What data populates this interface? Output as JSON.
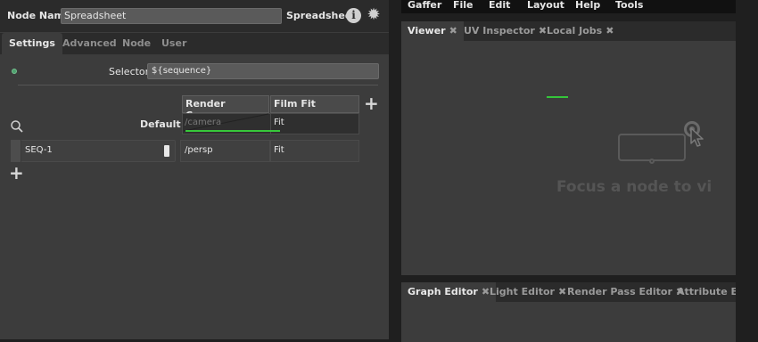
{
  "node_editor": {
    "node_name_label": "Node Name",
    "node_name_value": "Spreadsheet",
    "node_type": "Spreadsheet",
    "info_icon": "info-icon",
    "gear_icon": "gear-icon",
    "tabs": [
      {
        "label": "Settings",
        "active": true
      },
      {
        "label": "Advanced",
        "active": false
      },
      {
        "label": "Node",
        "active": false
      },
      {
        "label": "User",
        "active": false
      }
    ],
    "selector_label": "Selector",
    "selector_value": "${sequence}",
    "spreadsheet": {
      "columns": [
        "Render Camera",
        "Film Fit"
      ],
      "default_row": {
        "label": "Default",
        "camera": "/camera",
        "film_fit": "Fit"
      },
      "rows": [
        {
          "name": "SEQ-1",
          "camera": "/persp",
          "film_fit": "Fit"
        }
      ],
      "add_column_icon": "plus-icon",
      "add_row_icon": "plus-icon",
      "search_icon": "search-icon"
    },
    "accent_color": "#37c83a"
  },
  "menubar": {
    "items": [
      "Gaffer",
      "File",
      "Edit",
      "Layout",
      "Help",
      "Tools"
    ]
  },
  "viewer_panel": {
    "tabs": [
      {
        "label": "Viewer",
        "active": true
      },
      {
        "label": "UV Inspector",
        "active": false
      },
      {
        "label": "Local Jobs",
        "active": false
      }
    ],
    "message": "Focus a node to vi"
  },
  "graph_panel": {
    "tabs": [
      {
        "label": "Graph Editor",
        "active": true
      },
      {
        "label": "Light Editor",
        "active": false
      },
      {
        "label": "Render Pass Editor",
        "active": false
      },
      {
        "label": "Attribute Edito",
        "active": false
      }
    ]
  }
}
